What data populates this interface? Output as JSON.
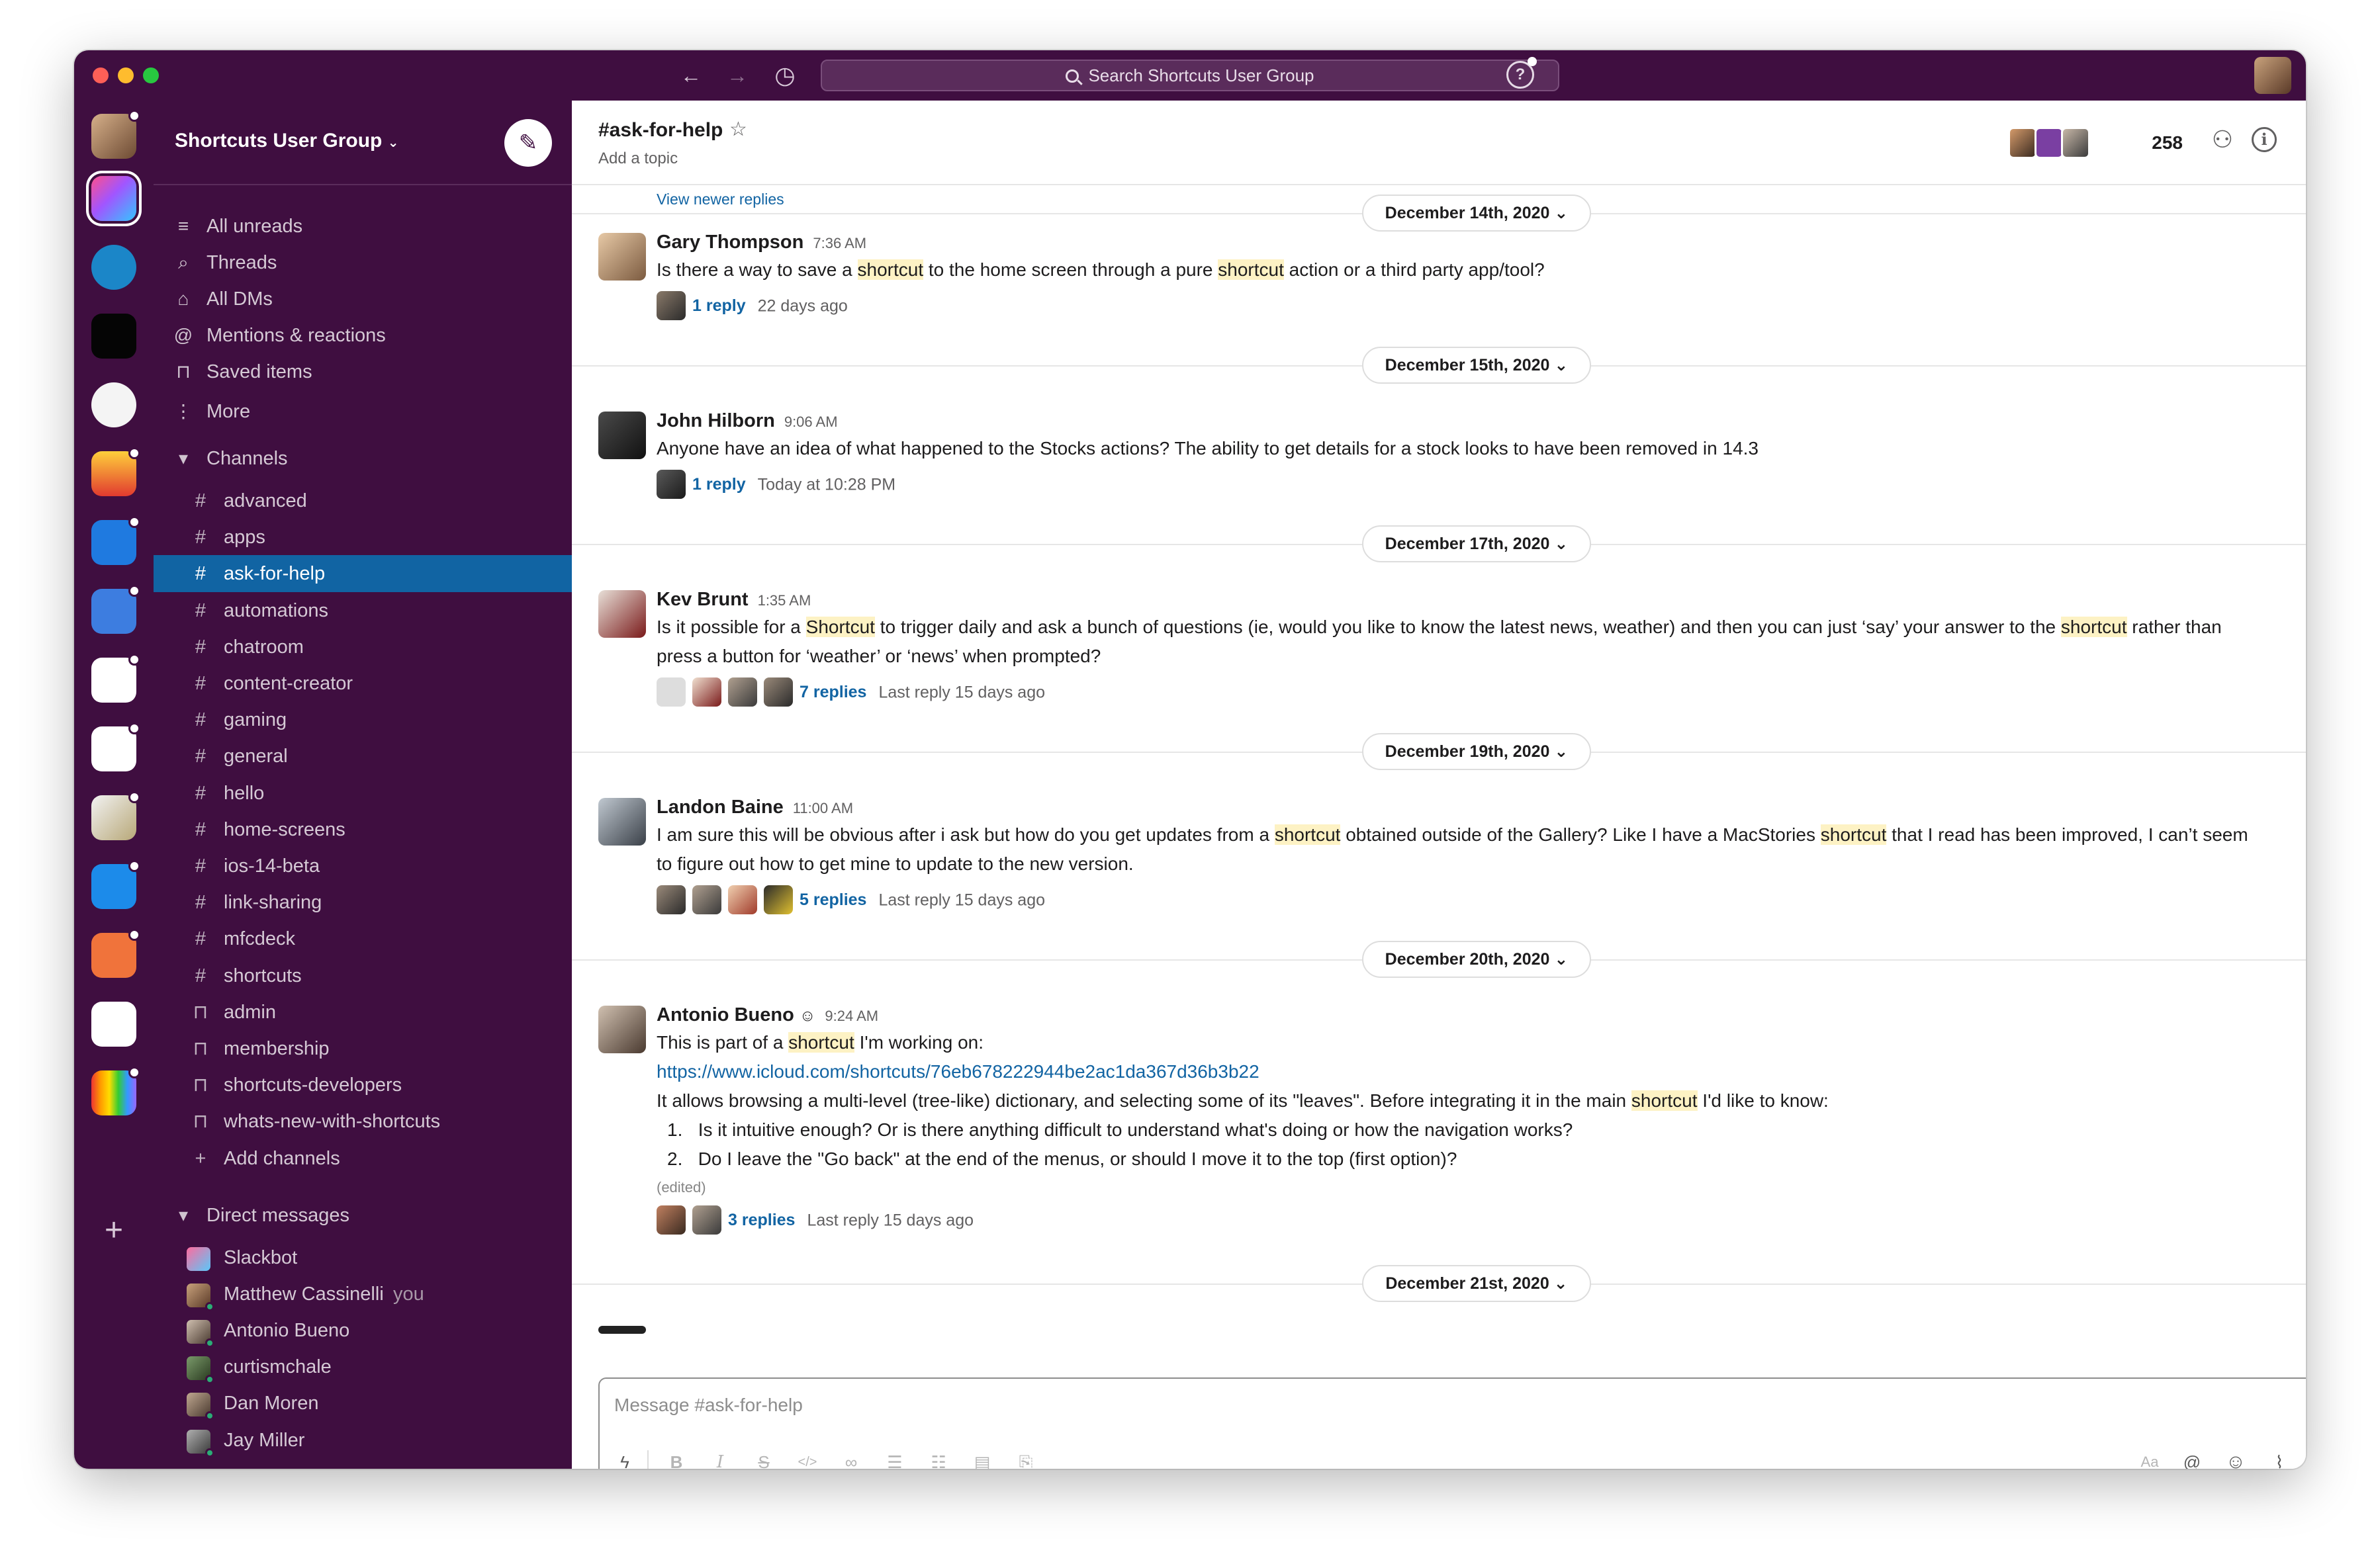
{
  "titlebar": {
    "search_text": "Search Shortcuts User Group",
    "help_label": "?"
  },
  "workspace_name": "Shortcuts User Group",
  "sidebar": {
    "nav": [
      {
        "label": "All unreads",
        "icon": "all-unreads-icon"
      },
      {
        "label": "Threads",
        "icon": "threads-icon"
      },
      {
        "label": "All DMs",
        "icon": "dms-icon"
      },
      {
        "label": "Mentions & reactions",
        "icon": "mentions-icon"
      },
      {
        "label": "Saved items",
        "icon": "bookmark-icon"
      },
      {
        "label": "More",
        "icon": "more-icon"
      }
    ],
    "channels_header": "Channels",
    "channels": [
      {
        "name": "advanced",
        "private": false
      },
      {
        "name": "apps",
        "private": false
      },
      {
        "name": "ask-for-help",
        "private": false,
        "active": true
      },
      {
        "name": "automations",
        "private": false
      },
      {
        "name": "chatroom",
        "private": false
      },
      {
        "name": "content-creator",
        "private": false
      },
      {
        "name": "gaming",
        "private": false
      },
      {
        "name": "general",
        "private": false
      },
      {
        "name": "hello",
        "private": false
      },
      {
        "name": "home-screens",
        "private": false
      },
      {
        "name": "ios-14-beta",
        "private": false
      },
      {
        "name": "link-sharing",
        "private": false
      },
      {
        "name": "mfcdeck",
        "private": false
      },
      {
        "name": "shortcuts",
        "private": false
      },
      {
        "name": "admin",
        "private": true
      },
      {
        "name": "membership",
        "private": true
      },
      {
        "name": "shortcuts-developers",
        "private": true
      },
      {
        "name": "whats-new-with-shortcuts",
        "private": true
      }
    ],
    "add_channels": "Add channels",
    "dms_header": "Direct messages",
    "dms": [
      {
        "name": "Slackbot",
        "suffix": ""
      },
      {
        "name": "Matthew Cassinelli",
        "suffix": "you"
      },
      {
        "name": "Antonio Bueno",
        "suffix": ""
      },
      {
        "name": "curtismchale",
        "suffix": ""
      },
      {
        "name": "Dan Moren",
        "suffix": ""
      },
      {
        "name": "Jay Miller",
        "suffix": ""
      }
    ]
  },
  "channel": {
    "title": "#ask-for-help",
    "topic": "Add a topic",
    "member_count": "258"
  },
  "messages_view": {
    "view_newer": "View newer replies",
    "dates": [
      "December 14th, 2020",
      "December 15th, 2020",
      "December 17th, 2020",
      "December 19th, 2020",
      "December 20th, 2020",
      "December 21st, 2020"
    ],
    "messages": [
      {
        "author": "Gary Thompson",
        "time": "7:36 AM",
        "replies": "1 reply",
        "last": "22 days ago"
      },
      {
        "author": "John Hilborn",
        "time": "9:06 AM",
        "text": "Anyone have an idea of what happened to the Stocks actions? The ability to get details for a stock looks to have been removed in 14.3",
        "replies": "1 reply",
        "last": "Today at 10:28 PM"
      },
      {
        "author": "Kev Brunt",
        "time": "1:35 AM",
        "replies": "7 replies",
        "last": "Last reply 15 days ago"
      },
      {
        "author": "Landon Baine",
        "time": "11:00 AM",
        "replies": "5 replies",
        "last": "Last reply 15 days ago"
      },
      {
        "author": "Antonio Bueno",
        "time": "9:24 AM",
        "link": "https://www.icloud.com/shortcuts/76eb678222944be2ac1da367d36b3b22",
        "list": [
          "Is it intuitive enough? Or is there anything difficult to understand what's doing or how the navigation works?",
          "Do I leave the \"Go back\" at the end of the menus, or should I move it to the top (first option)?"
        ],
        "edited": "(edited)",
        "replies": "3 replies",
        "last": "Last reply 15 days ago"
      }
    ]
  },
  "highlight_word": "shortcut",
  "composer": {
    "placeholder": "Message #ask-for-help",
    "aa_label": "Aa",
    "at_label": "@"
  },
  "colors": {
    "aubergine": "#3f0e40",
    "active_channel": "#1164a3",
    "link": "#1264a3",
    "highlight": "#fdf2c4"
  }
}
